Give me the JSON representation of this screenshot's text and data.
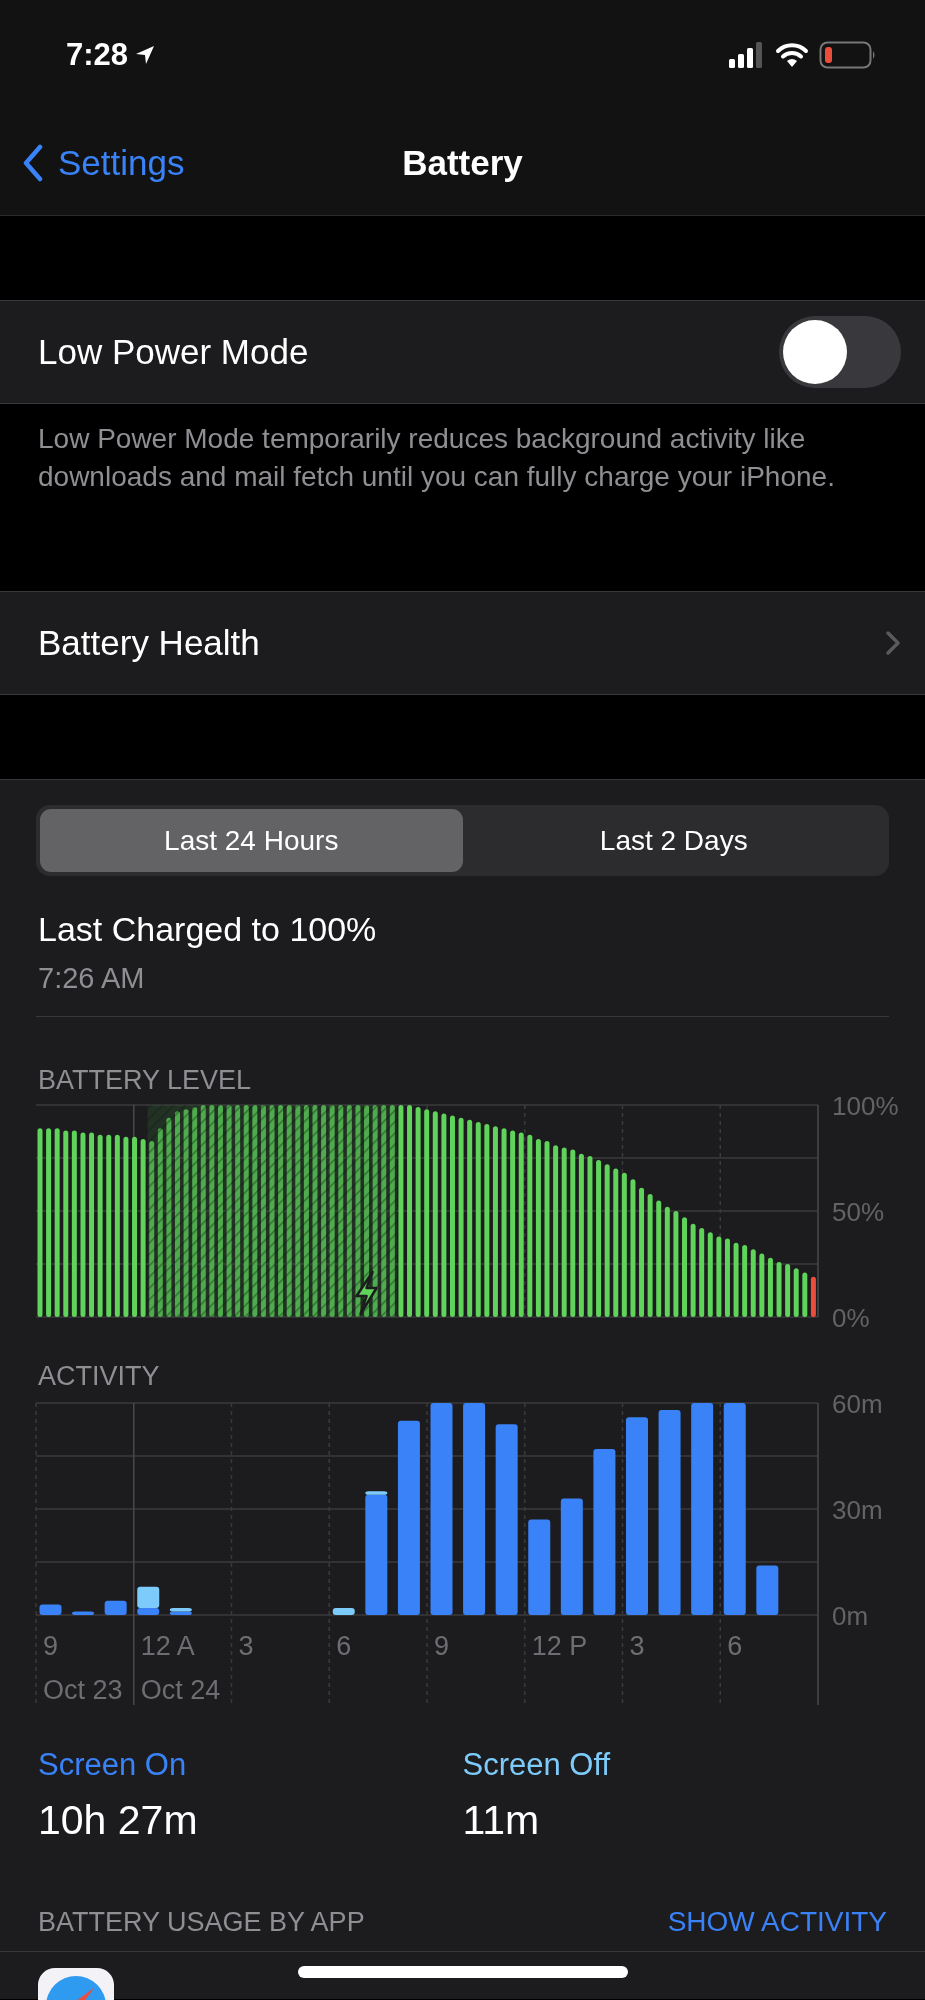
{
  "status_bar": {
    "time": "7:28"
  },
  "nav": {
    "back": "Settings",
    "title": "Battery"
  },
  "low_power": {
    "label": "Low Power Mode",
    "on": false,
    "footer": "Low Power Mode temporarily reduces background activity like downloads and mail fetch until you can fully charge your iPhone."
  },
  "battery_health": {
    "label": "Battery Health"
  },
  "range_tabs": [
    {
      "label": "Last 24 Hours",
      "selected": true
    },
    {
      "label": "Last 2 Days",
      "selected": false
    }
  ],
  "last_charged": {
    "title": "Last Charged to 100%",
    "time": "7:26 AM"
  },
  "battery_level": {
    "chart_data": {
      "type": "bar",
      "title": "BATTERY LEVEL",
      "stacked": true,
      "ylim": [
        0,
        100
      ],
      "yticks": [
        {
          "value": 0,
          "label": "0%"
        },
        {
          "value": 50,
          "label": "50%"
        },
        {
          "value": 100,
          "label": "100%"
        }
      ],
      "series": [
        {
          "color": "#5fd35a",
          "values": [
            89,
            89,
            89,
            88,
            88,
            87,
            87,
            86,
            86,
            86,
            85,
            85,
            84,
            83,
            89,
            94,
            97,
            98,
            99,
            100,
            100,
            100,
            100,
            100,
            100,
            100,
            100,
            100,
            100,
            100,
            100,
            100,
            100,
            100,
            100,
            100,
            100,
            100,
            100,
            100,
            100,
            100,
            100,
            100,
            99,
            98,
            97,
            96,
            95,
            94,
            93,
            92,
            91,
            90,
            89,
            88,
            87,
            86,
            84,
            83,
            81,
            80,
            79,
            77,
            76,
            74,
            72,
            70,
            68,
            65,
            61,
            58,
            55,
            52,
            50,
            47,
            44,
            42,
            40,
            38,
            37,
            35,
            34,
            32,
            30,
            28,
            26,
            25,
            23,
            21,
            null
          ]
        },
        {
          "color": "#eb4d3d",
          "values": [
            null,
            null,
            null,
            null,
            null,
            null,
            null,
            null,
            null,
            null,
            null,
            null,
            null,
            null,
            null,
            null,
            null,
            null,
            null,
            null,
            null,
            null,
            null,
            null,
            null,
            null,
            null,
            null,
            null,
            null,
            null,
            null,
            null,
            null,
            null,
            null,
            null,
            null,
            null,
            null,
            null,
            null,
            null,
            null,
            null,
            null,
            null,
            null,
            null,
            null,
            null,
            null,
            null,
            null,
            null,
            null,
            null,
            null,
            null,
            null,
            null,
            null,
            null,
            null,
            null,
            null,
            null,
            null,
            null,
            null,
            null,
            null,
            null,
            null,
            null,
            null,
            null,
            null,
            null,
            null,
            null,
            null,
            null,
            null,
            null,
            null,
            null,
            null,
            null,
            null,
            19
          ]
        }
      ]
    }
  },
  "activity": {
    "chart_data": {
      "type": "bar",
      "title": "ACTIVITY",
      "stacked": true,
      "ylim": [
        0,
        60
      ],
      "yticks": [
        {
          "value": 0,
          "label": "0m"
        },
        {
          "value": 30,
          "label": "30m"
        },
        {
          "value": 60,
          "label": "60m"
        }
      ],
      "categories": [
        "9",
        null,
        null,
        "12 A",
        null,
        null,
        "3",
        null,
        null,
        "6",
        null,
        null,
        "9",
        null,
        null,
        "12 P",
        null,
        null,
        "3",
        null,
        null,
        "6",
        null,
        null
      ],
      "series": [
        {
          "name": "Screen On",
          "color": "#3a82f7",
          "values": [
            3,
            1,
            4,
            2,
            1,
            0,
            0,
            0,
            0,
            0,
            34,
            55,
            60,
            60,
            54,
            27,
            33,
            47,
            56,
            58,
            60,
            60,
            14,
            0
          ]
        },
        {
          "name": "Screen Off",
          "color": "#7dcbfa",
          "values": [
            0,
            0,
            0,
            6,
            1,
            0,
            0,
            0,
            0,
            2,
            1,
            0,
            0,
            0,
            0,
            0,
            0,
            0,
            0,
            0,
            0,
            0,
            0,
            0
          ]
        }
      ],
      "annotations": [
        "Oct 23",
        "Oct 24"
      ]
    }
  },
  "screen_time": [
    {
      "value": "10h 27m"
    },
    {
      "value": "11m"
    }
  ],
  "usage": {
    "title": "BATTERY USAGE BY APP",
    "action": "SHOW ACTIVITY"
  }
}
